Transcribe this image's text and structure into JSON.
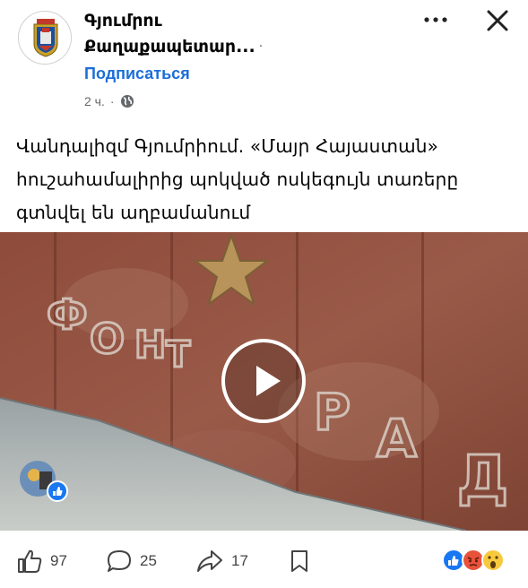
{
  "header": {
    "page_name_line1": "Գյումրու",
    "page_name_line2": "Քաղաքապետար...",
    "separator": "·",
    "subscribe_label": "Подписаться",
    "time_ago": "2 ч.",
    "time_separator": "·"
  },
  "post": {
    "text": "Վանդալիզմ Գյումրիում. «Մայր Հայաստան» հուշահամալիրից պոկված ոսկեգույն տառերը գտնվել են աղբամանում"
  },
  "video": {
    "wall_letters": [
      "Ф",
      "О",
      "Н",
      "Т",
      "Р",
      "А",
      "Д"
    ]
  },
  "actions": {
    "likes": "97",
    "comments": "25",
    "shares": "17"
  },
  "icons": {
    "globe": "globe-icon",
    "more": "more-options-icon",
    "close": "close-icon",
    "like": "thumbs-up-icon",
    "comment": "comment-bubble-icon",
    "share": "share-arrow-icon",
    "save": "bookmark-icon",
    "play": "play-icon"
  },
  "colors": {
    "accent": "#1c6ed8",
    "secondary_text": "#65676b",
    "wall": "#8a4a3a",
    "star": "#b8935a"
  }
}
